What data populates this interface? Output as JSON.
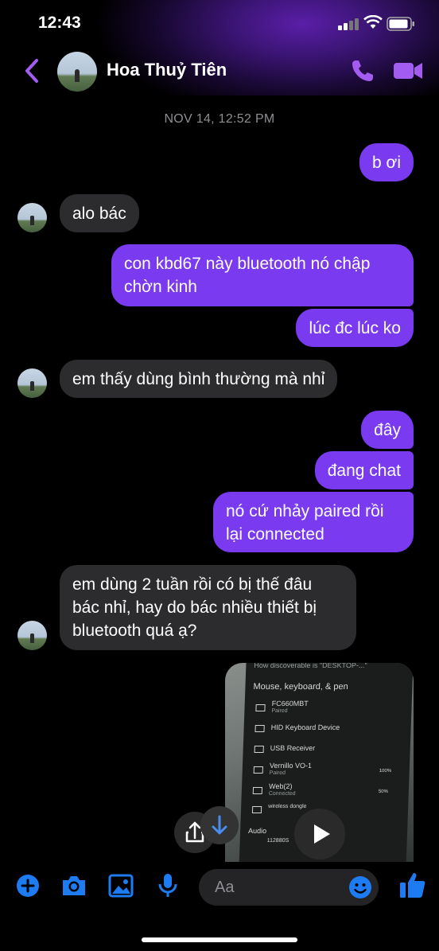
{
  "status_bar": {
    "time": "12:43"
  },
  "header": {
    "contact_name": "Hoa Thuỷ Tiên"
  },
  "timestamp": "NOV 14, 12:52 PM",
  "messages": [
    {
      "side": "out",
      "lines": [
        "b ơi"
      ]
    },
    {
      "side": "in",
      "lines": [
        "alo bác"
      ]
    },
    {
      "side": "out",
      "lines": [
        "con kbd67 này bluetooth nó chập",
        "chờn kinh"
      ]
    },
    {
      "side": "out",
      "lines": [
        "lúc đc lúc ko"
      ]
    },
    {
      "side": "in",
      "lines": [
        "em thấy dùng bình thường mà nhỉ"
      ]
    },
    {
      "side": "out",
      "lines": [
        "đây"
      ]
    },
    {
      "side": "out",
      "lines": [
        "đang chat"
      ]
    },
    {
      "side": "out",
      "lines": [
        "nó cứ nhảy paired rồi",
        "lại connected"
      ]
    },
    {
      "side": "in",
      "lines": [
        "em dùng 2 tuần rồi có bị thế đâu",
        "bác nhỉ, hay do bác nhiều thiết bị",
        "bluetooth quá ạ?"
      ]
    }
  ],
  "video_screen": {
    "top_text": "How discoverable is \"DESKTOP-...\"",
    "section": "Mouse, keyboard, & pen",
    "devices": [
      {
        "name": "FC660MBT",
        "status": "Paired"
      },
      {
        "name": "HID Keyboard Device",
        "status": ""
      },
      {
        "name": "USB Receiver",
        "status": ""
      },
      {
        "name": "Vernillo VO-1",
        "status": "Paired",
        "level": "100%"
      },
      {
        "name": "Web(2)",
        "status": "Connected",
        "level": "50%"
      },
      {
        "name": "wireless dongle",
        "status": ""
      }
    ],
    "audio_label": "Audio",
    "audio_device": "112880S"
  },
  "composer": {
    "placeholder": "Aa"
  },
  "colors": {
    "accent": "#7a3af0",
    "incoming": "#2c2c2e",
    "icon_purple": "#a35cf0",
    "icon_blue": "#1e7cf2"
  }
}
